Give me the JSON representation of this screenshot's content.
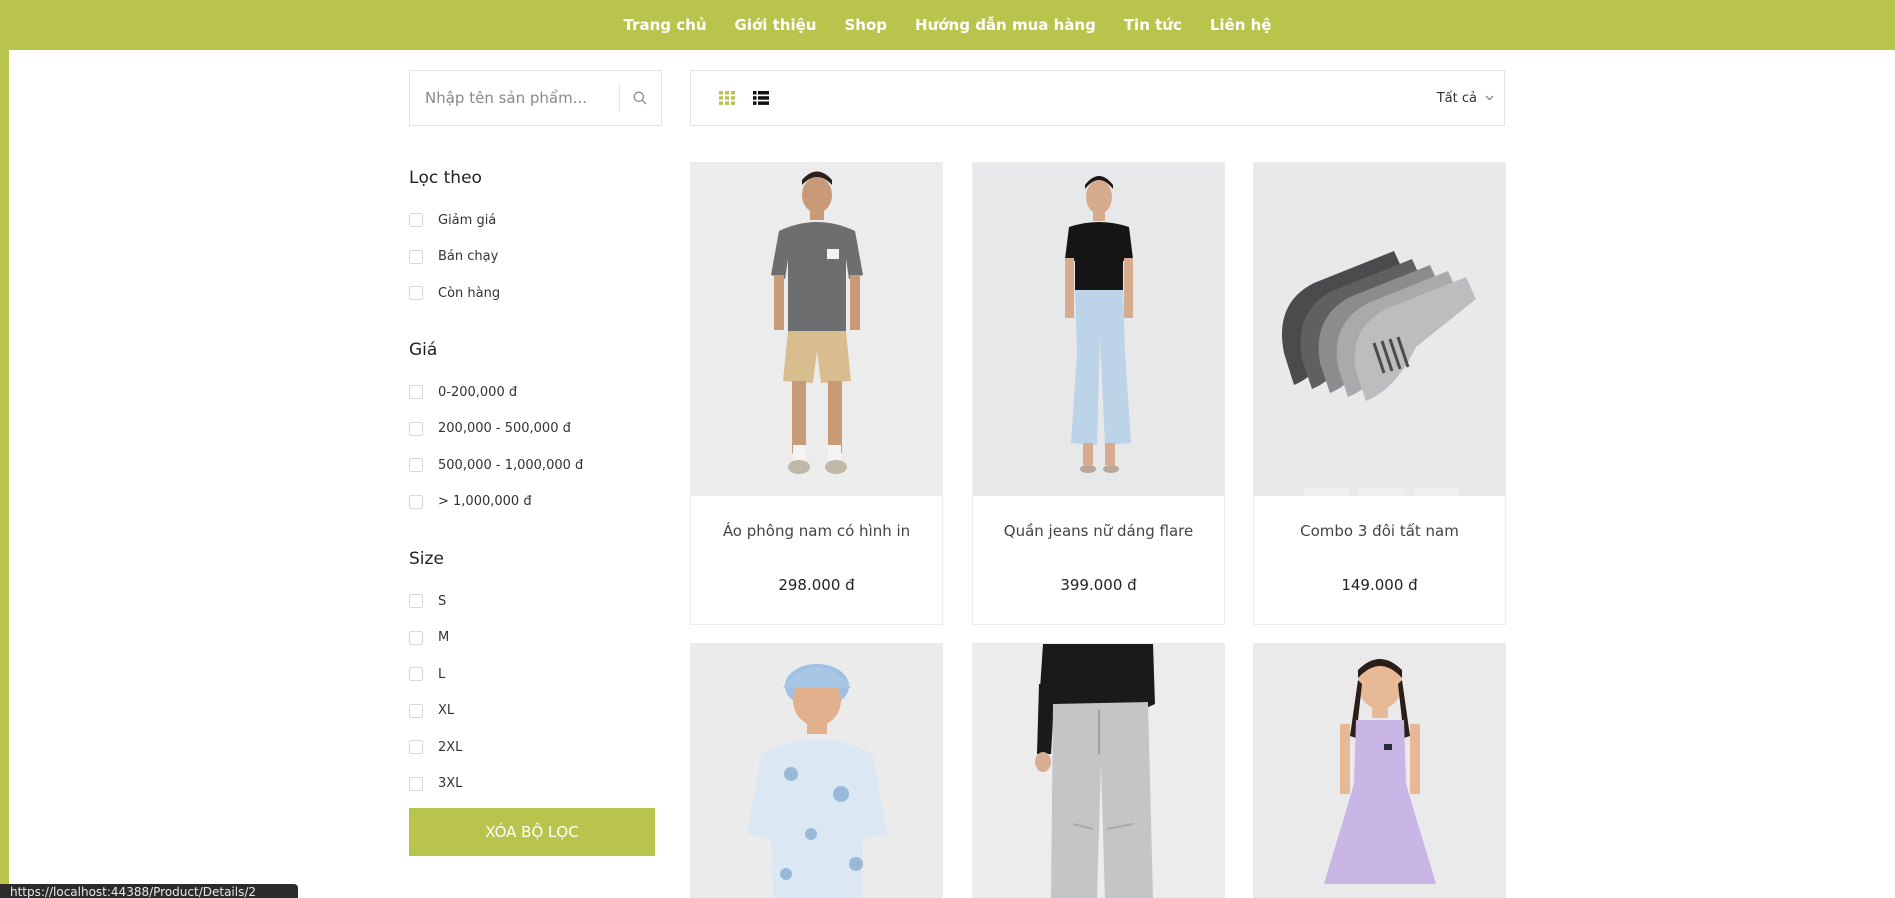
{
  "nav": {
    "items": [
      "Trang chủ",
      "Giới thiệu",
      "Shop",
      "Hướng dẫn mua hàng",
      "Tin tức",
      "Liên hệ"
    ]
  },
  "search": {
    "placeholder": "Nhập tên sản phẩm..."
  },
  "filters": {
    "loc_theo": {
      "title": "Lọc theo",
      "options": [
        "Giảm giá",
        "Bán chạy",
        "Còn hàng"
      ]
    },
    "gia": {
      "title": "Giá",
      "options": [
        "0-200,000 đ",
        "200,000 - 500,000 đ",
        "500,000 - 1,000,000 đ",
        "> 1,000,000 đ"
      ]
    },
    "size": {
      "title": "Size",
      "options": [
        "S",
        "M",
        "L",
        "XL",
        "2XL",
        "3XL"
      ]
    },
    "clear_label": "XÓA BỘ LỌC"
  },
  "toolbar": {
    "sort_label": "Tất cả"
  },
  "products": [
    {
      "name": "Áo phông nam có hình in",
      "price": "298.000 đ"
    },
    {
      "name": "Quần jeans nữ dáng flare",
      "price": "399.000 đ"
    },
    {
      "name": "Combo 3 đôi tất nam",
      "price": "149.000 đ"
    },
    {
      "name": "",
      "price": ""
    },
    {
      "name": "",
      "price": ""
    },
    {
      "name": "",
      "price": ""
    }
  ],
  "status_url": "https://localhost:44388/Product/Details/2",
  "colors": {
    "accent": "#b9c44d",
    "border": "#e2e2e2"
  },
  "icons": {
    "search": "search-icon",
    "grid": "grid-view-icon",
    "list": "list-view-icon",
    "sort": "chevron-down-icon"
  }
}
